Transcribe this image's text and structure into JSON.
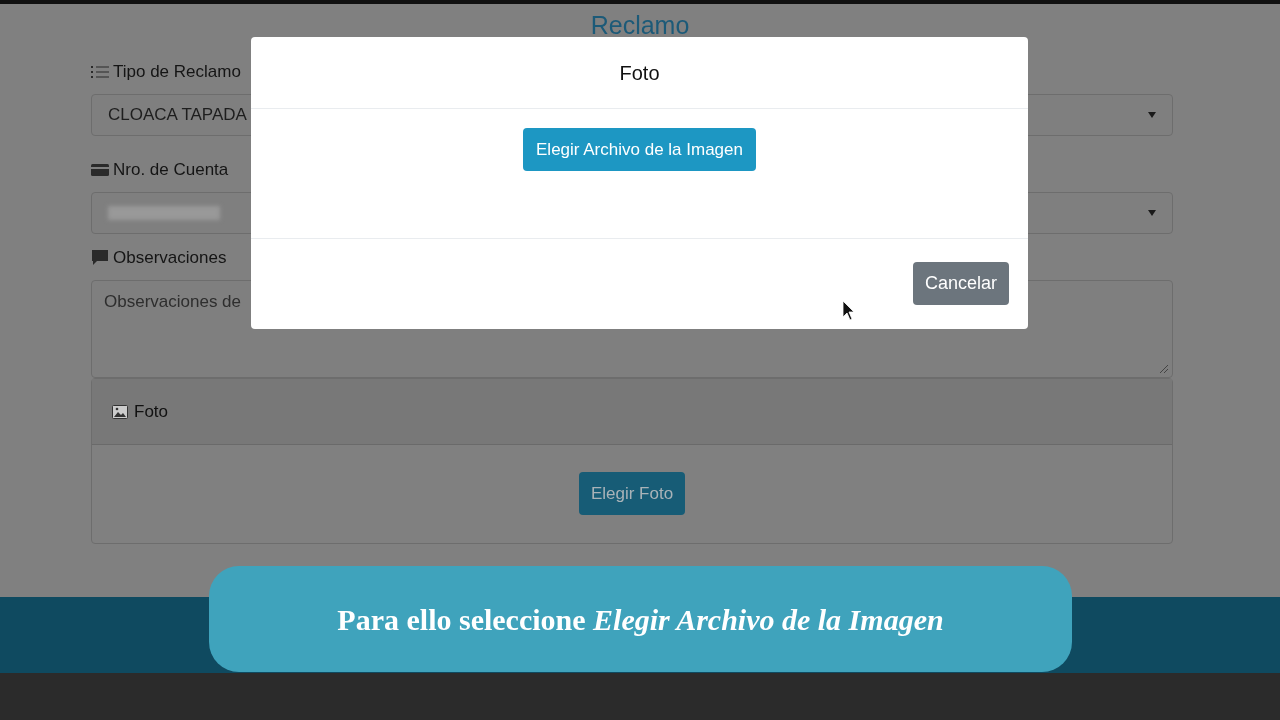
{
  "page": {
    "title": "Reclamo",
    "fields": [
      {
        "kind": "select",
        "label": "Tipo de Reclamo",
        "value": "CLOACA TAPADA"
      },
      {
        "kind": "select",
        "label": "Nro. de Cuenta"
      },
      {
        "kind": "textarea",
        "label": "Observaciones",
        "placeholder": "Observaciones de"
      }
    ],
    "photo_card": {
      "title": "Foto",
      "button": "Elegir Foto"
    }
  },
  "modal": {
    "title": "Foto",
    "primary_button": "Elegir Archivo de la Imagen",
    "cancel_button": "Cancelar"
  },
  "caption": "Para ello seleccione *Elegir Archivo de la Imagen*"
}
